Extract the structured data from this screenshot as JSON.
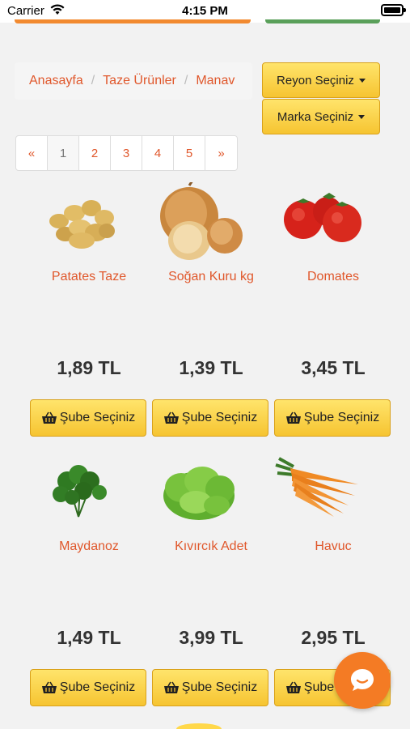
{
  "status": {
    "carrier": "Carrier",
    "time": "4:15 PM"
  },
  "breadcrumb": {
    "items": [
      "Anasayfa",
      "Taze Ürünler",
      "Manav"
    ]
  },
  "filters": {
    "reyon_label": "Reyon Seçiniz",
    "marka_label": "Marka Seçiniz"
  },
  "pagination": {
    "prev": "«",
    "pages": [
      "1",
      "2",
      "3",
      "4",
      "5"
    ],
    "next": "»",
    "active": "1"
  },
  "products": [
    {
      "name": "Patates Taze",
      "price": "1,89 TL",
      "button": "Şube Seçiniz",
      "image": "potato"
    },
    {
      "name": "Soğan Kuru kg",
      "price": "1,39 TL",
      "button": "Şube Seçiniz",
      "image": "onion"
    },
    {
      "name": "Domates",
      "price": "3,45 TL",
      "button": "Şube Seçiniz",
      "image": "tomato"
    },
    {
      "name": "Maydanoz",
      "price": "1,49 TL",
      "button": "Şube Seçiniz",
      "image": "parsley"
    },
    {
      "name": "Kıvırcık Adet",
      "price": "3,99 TL",
      "button": "Şube Seçiniz",
      "image": "lettuce"
    },
    {
      "name": "Havuc",
      "price": "2,95 TL",
      "button": "Şube Seçiniz",
      "image": "carrot"
    }
  ],
  "colors": {
    "accent": "#e0572b",
    "button": "#f6c431",
    "chat": "#f47b24"
  }
}
